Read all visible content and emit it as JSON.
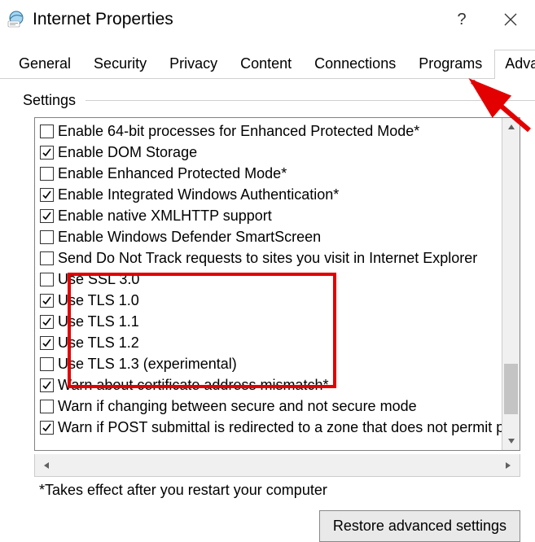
{
  "window": {
    "title": "Internet Properties"
  },
  "tabs": [
    {
      "label": "General"
    },
    {
      "label": "Security"
    },
    {
      "label": "Privacy"
    },
    {
      "label": "Content"
    },
    {
      "label": "Connections"
    },
    {
      "label": "Programs"
    },
    {
      "label": "Advanced"
    }
  ],
  "active_tab": "Advanced",
  "section": {
    "label": "Settings"
  },
  "options": [
    {
      "label": "Enable 64-bit processes for Enhanced Protected Mode*",
      "checked": false
    },
    {
      "label": "Enable DOM Storage",
      "checked": true
    },
    {
      "label": "Enable Enhanced Protected Mode*",
      "checked": false
    },
    {
      "label": "Enable Integrated Windows Authentication*",
      "checked": true
    },
    {
      "label": "Enable native XMLHTTP support",
      "checked": true
    },
    {
      "label": "Enable Windows Defender SmartScreen",
      "checked": false
    },
    {
      "label": "Send Do Not Track requests to sites you visit in Internet Explorer",
      "checked": false
    },
    {
      "label": "Use SSL 3.0",
      "checked": false
    },
    {
      "label": "Use TLS 1.0",
      "checked": true
    },
    {
      "label": "Use TLS 1.1",
      "checked": true
    },
    {
      "label": "Use TLS 1.2",
      "checked": true
    },
    {
      "label": "Use TLS 1.3 (experimental)",
      "checked": false
    },
    {
      "label": "Warn about certificate address mismatch*",
      "checked": true
    },
    {
      "label": "Warn if changing between secure and not secure mode",
      "checked": false
    },
    {
      "label": "Warn if POST submittal is redirected to a zone that does not permit posts",
      "checked": true
    }
  ],
  "note": "*Takes effect after you restart your computer",
  "buttons": {
    "restore": "Restore advanced settings"
  }
}
